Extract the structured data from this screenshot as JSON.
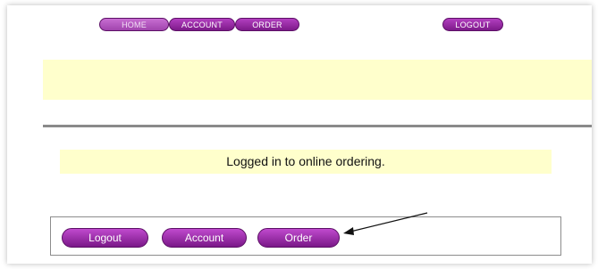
{
  "topnav": {
    "home_label": "HOME",
    "account_label": "ACCOUNT",
    "order_label": "ORDER",
    "logout_label": "LOGOUT"
  },
  "status": {
    "message": "Logged in to online ordering."
  },
  "actions": {
    "logout_label": "Logout",
    "account_label": "Account",
    "order_label": "Order"
  },
  "colors": {
    "button_purple": "#8e24aa",
    "highlight_yellow": "#ffffcc",
    "divider_gray": "#8a8a8a"
  }
}
